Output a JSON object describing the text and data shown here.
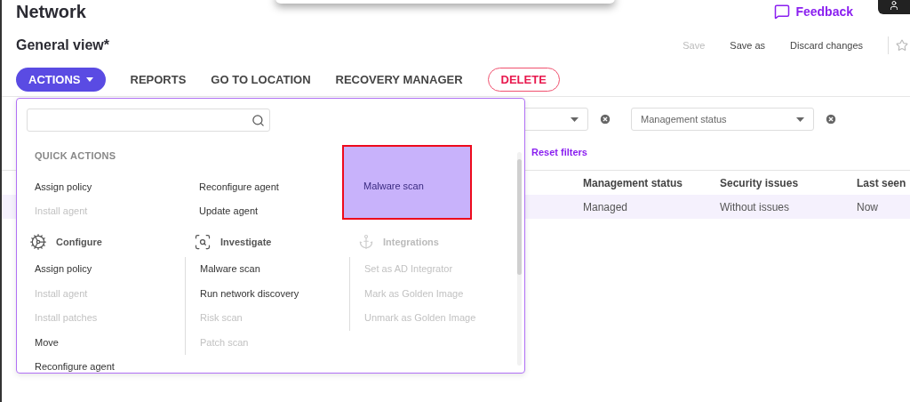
{
  "page": {
    "title": "Network",
    "feedback": "Feedback"
  },
  "view": {
    "title": "General view*",
    "favorite": false,
    "actions": [
      {
        "label": "Save",
        "disabled": true
      },
      {
        "label": "Save as",
        "disabled": false
      },
      {
        "label": "Discard changes",
        "disabled": false
      }
    ]
  },
  "toolbar": [
    {
      "label": "ACTIONS",
      "kind": "dropdown",
      "expanded": true
    },
    {
      "label": "REPORTS",
      "kind": "plain"
    },
    {
      "label": "GO TO LOCATION",
      "kind": "plain"
    },
    {
      "label": "RECOVERY MANAGER",
      "kind": "plain"
    },
    {
      "label": "DELETE",
      "kind": "danger"
    }
  ],
  "actions_menu": {
    "quick_actions": {
      "title": "QUICK ACTIONS",
      "columns": [
        [
          {
            "label": "Assign policy",
            "disabled": false,
            "selected": false
          },
          {
            "label": "Install agent",
            "disabled": true,
            "selected": false
          }
        ],
        [
          {
            "label": "Reconfigure agent",
            "disabled": false,
            "selected": false
          },
          {
            "label": "Update agent",
            "disabled": false,
            "selected": false
          }
        ],
        [
          {
            "label": "Malware scan",
            "disabled": false,
            "selected": true
          }
        ]
      ]
    },
    "sections": [
      {
        "title": "Configure",
        "kind": "configure",
        "disabled": false,
        "items": [
          {
            "label": "Assign policy",
            "disabled": false
          },
          {
            "label": "Install agent",
            "disabled": true
          },
          {
            "label": "Install patches",
            "disabled": true
          },
          {
            "label": "Move",
            "disabled": false
          },
          {
            "label": "Reconfigure agent",
            "disabled": false
          }
        ]
      },
      {
        "title": "Investigate",
        "kind": "investigate",
        "disabled": false,
        "items": [
          {
            "label": "Malware scan",
            "disabled": false
          },
          {
            "label": "Run network discovery",
            "disabled": false
          },
          {
            "label": "Risk scan",
            "disabled": true
          },
          {
            "label": "Patch scan",
            "disabled": true
          }
        ]
      },
      {
        "title": "Integrations",
        "kind": "integrations",
        "disabled": true,
        "items": [
          {
            "label": "Set as AD Integrator",
            "disabled": true
          },
          {
            "label": "Mark as Golden Image",
            "disabled": true
          },
          {
            "label": "Unmark as Golden Image",
            "disabled": true
          }
        ]
      }
    ]
  },
  "filters": [
    {
      "covered": true
    },
    {
      "covered": false,
      "placeholder": "Management status"
    }
  ],
  "reset_filters": "Reset filters",
  "table": {
    "columns": [
      "Management status",
      "Security issues",
      "Last seen"
    ],
    "rows": [
      {
        "cells": [
          "Managed",
          "Without issues",
          "Now"
        ],
        "selected": true
      }
    ]
  }
}
